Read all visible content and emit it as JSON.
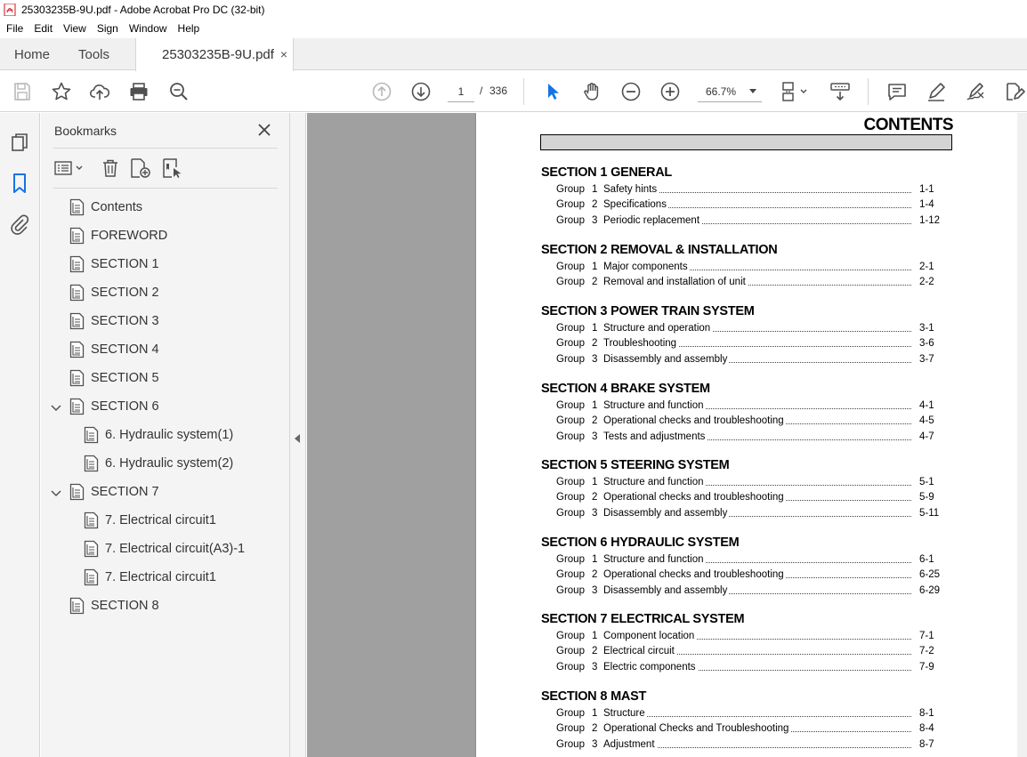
{
  "window": {
    "title": "25303235B-9U.pdf - Adobe Acrobat Pro DC (32-bit)"
  },
  "menu": [
    "File",
    "Edit",
    "View",
    "Sign",
    "Window",
    "Help"
  ],
  "tabs": {
    "home": "Home",
    "tools": "Tools",
    "document": "25303235B-9U.pdf",
    "close": "×"
  },
  "toolbar": {
    "current_page": "1",
    "page_separator": "/",
    "total_pages": "336",
    "zoom": "66.7%"
  },
  "bookmarks": {
    "title": "Bookmarks",
    "items": [
      {
        "label": "Contents",
        "level": 0
      },
      {
        "label": "FOREWORD",
        "level": 0
      },
      {
        "label": "SECTION 1",
        "level": 0
      },
      {
        "label": "SECTION 2",
        "level": 0
      },
      {
        "label": "SECTION 3",
        "level": 0
      },
      {
        "label": "SECTION 4",
        "level": 0
      },
      {
        "label": "SECTION 5",
        "level": 0
      },
      {
        "label": "SECTION 6",
        "level": 0,
        "expanded": true
      },
      {
        "label": "6. Hydraulic system(1)",
        "level": 1
      },
      {
        "label": "6. Hydraulic system(2)",
        "level": 1
      },
      {
        "label": "SECTION 7",
        "level": 0,
        "expanded": true
      },
      {
        "label": "7. Electrical circuit1",
        "level": 1
      },
      {
        "label": "7. Electrical circuit(A3)-1",
        "level": 1
      },
      {
        "label": "7. Electrical circuit1",
        "level": 1
      },
      {
        "label": "SECTION 8",
        "level": 0
      }
    ]
  },
  "document": {
    "heading": "CONTENTS",
    "sections": [
      {
        "label": "SECTION",
        "num": "1",
        "title": "GENERAL",
        "groups": [
          {
            "word": "Group",
            "num": "1",
            "title": "Safety hints",
            "page": "1-1"
          },
          {
            "word": "Group",
            "num": "2",
            "title": "Specifications",
            "page": "1-4"
          },
          {
            "word": "Group",
            "num": "3",
            "title": "Periodic replacement",
            "page": "1-12"
          }
        ]
      },
      {
        "label": "SECTION",
        "num": "2",
        "title": "REMOVAL & INSTALLATION",
        "groups": [
          {
            "word": "Group",
            "num": "1",
            "title": "Major components",
            "page": "2-1"
          },
          {
            "word": "Group",
            "num": "2",
            "title": "Removal and installation of unit",
            "page": "2-2"
          }
        ]
      },
      {
        "label": "SECTION",
        "num": "3",
        "title": "POWER TRAIN SYSTEM",
        "groups": [
          {
            "word": "Group",
            "num": "1",
            "title": "Structure and operation",
            "page": "3-1"
          },
          {
            "word": "Group",
            "num": "2",
            "title": "Troubleshooting",
            "page": "3-6"
          },
          {
            "word": "Group",
            "num": "3",
            "title": "Disassembly and assembly",
            "page": "3-7"
          }
        ]
      },
      {
        "label": "SECTION",
        "num": "4",
        "title": "BRAKE SYSTEM",
        "groups": [
          {
            "word": "Group",
            "num": "1",
            "title": "Structure and function",
            "page": "4-1"
          },
          {
            "word": "Group",
            "num": "2",
            "title": "Operational checks and troubleshooting",
            "page": "4-5"
          },
          {
            "word": "Group",
            "num": "3",
            "title": "Tests and adjustments",
            "page": "4-7"
          }
        ]
      },
      {
        "label": "SECTION",
        "num": "5",
        "title": "STEERING SYSTEM",
        "groups": [
          {
            "word": "Group",
            "num": "1",
            "title": "Structure and function",
            "page": "5-1"
          },
          {
            "word": "Group",
            "num": "2",
            "title": "Operational checks and troubleshooting",
            "page": "5-9"
          },
          {
            "word": "Group",
            "num": "3",
            "title": "Disassembly and assembly",
            "page": "5-11"
          }
        ]
      },
      {
        "label": "SECTION",
        "num": "6",
        "title": "HYDRAULIC SYSTEM",
        "groups": [
          {
            "word": "Group",
            "num": "1",
            "title": "Structure and function",
            "page": "6-1"
          },
          {
            "word": "Group",
            "num": "2",
            "title": "Operational checks and troubleshooting",
            "page": "6-25"
          },
          {
            "word": "Group",
            "num": "3",
            "title": "Disassembly and assembly",
            "page": "6-29"
          }
        ]
      },
      {
        "label": "SECTION",
        "num": "7",
        "title": "ELECTRICAL SYSTEM",
        "groups": [
          {
            "word": "Group",
            "num": "1",
            "title": "Component location",
            "page": "7-1"
          },
          {
            "word": "Group",
            "num": "2",
            "title": "Electrical circuit",
            "page": "7-2"
          },
          {
            "word": "Group",
            "num": "3",
            "title": "Electric components",
            "page": "7-9"
          }
        ]
      },
      {
        "label": "SECTION",
        "num": "8",
        "title": "MAST",
        "groups": [
          {
            "word": "Group",
            "num": "1",
            "title": "Structure",
            "page": "8-1"
          },
          {
            "word": "Group",
            "num": "2",
            "title": "Operational Checks and Troubleshooting",
            "page": "8-4"
          },
          {
            "word": "Group",
            "num": "3",
            "title": "Adjustment",
            "page": "8-7"
          }
        ]
      }
    ]
  },
  "colors": {
    "accent": "#1473e6",
    "pdf_red": "#d7373f",
    "icon": "#505050"
  }
}
